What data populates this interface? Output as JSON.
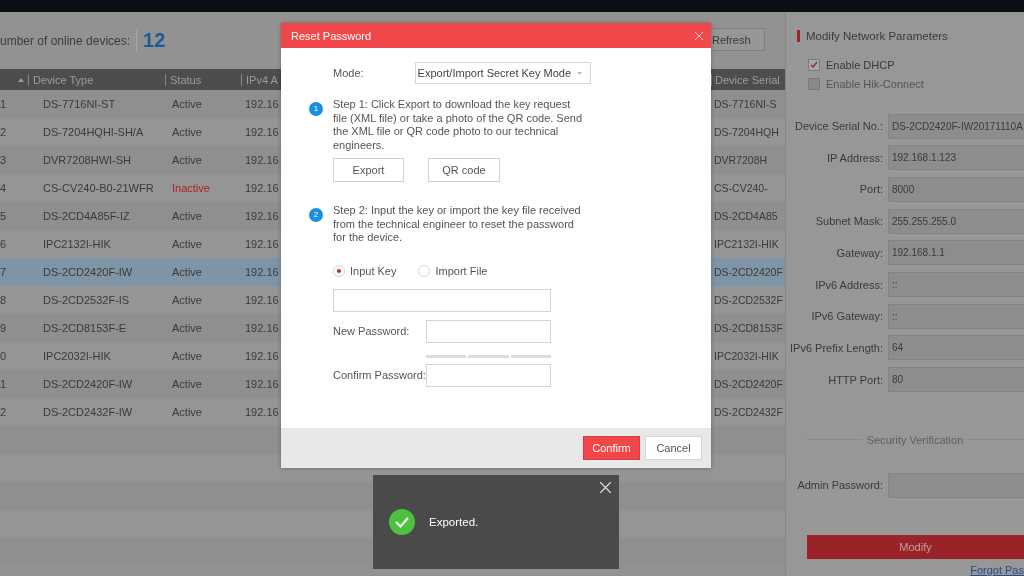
{
  "header": {
    "count_label": "umber of online devices:",
    "count": "12",
    "refresh": "Refresh"
  },
  "table": {
    "columns": [
      "Device Type",
      "Status",
      "IPv4 A",
      "Device Serial"
    ],
    "rows": [
      {
        "index": "1",
        "type": "DS-7716NI-ST",
        "status": "Active",
        "active": true,
        "ipv4": "192.16",
        "serial": "DS-7716NI-S",
        "selected": false
      },
      {
        "index": "2",
        "type": "DS-7204HQHI-SH/A",
        "status": "Active",
        "active": true,
        "ipv4": "192.16",
        "serial": "DS-7204HQH",
        "selected": false
      },
      {
        "index": "3",
        "type": "DVR7208HWI-SH",
        "status": "Active",
        "active": true,
        "ipv4": "192.16",
        "serial": "DVR7208H",
        "selected": false
      },
      {
        "index": "4",
        "type": "CS-CV240-B0-21WFR",
        "status": "Inactive",
        "active": false,
        "ipv4": "192.16",
        "serial": "CS-CV240-",
        "selected": false
      },
      {
        "index": "5",
        "type": "DS-2CD4A85F-IZ",
        "status": "Active",
        "active": true,
        "ipv4": "192.16",
        "serial": "DS-2CD4A85",
        "selected": false
      },
      {
        "index": "6",
        "type": "IPC2132I-HIK",
        "status": "Active",
        "active": true,
        "ipv4": "192.16",
        "serial": "IPC2132I-HIK",
        "selected": false
      },
      {
        "index": "7",
        "type": "DS-2CD2420F-IW",
        "status": "Active",
        "active": true,
        "ipv4": "192.16",
        "serial": "DS-2CD2420F",
        "selected": true
      },
      {
        "index": "8",
        "type": "DS-2CD2532F-IS",
        "status": "Active",
        "active": true,
        "ipv4": "192.16",
        "serial": "DS-2CD2532F",
        "selected": false
      },
      {
        "index": "9",
        "type": "DS-2CD8153F-E",
        "status": "Active",
        "active": true,
        "ipv4": "192.16",
        "serial": "DS-2CD8153F",
        "selected": false
      },
      {
        "index": "0",
        "type": "IPC2032I-HIK",
        "status": "Active",
        "active": true,
        "ipv4": "192.16",
        "serial": "IPC2032I-HIK",
        "selected": false
      },
      {
        "index": "1",
        "type": "DS-2CD2420F-IW",
        "status": "Active",
        "active": true,
        "ipv4": "192.16",
        "serial": "DS-2CD2420F",
        "selected": false
      },
      {
        "index": "2",
        "type": "DS-2CD2432F-IW",
        "status": "Active",
        "active": true,
        "ipv4": "192.16",
        "serial": "DS-2CD2432F",
        "selected": false
      }
    ]
  },
  "panel": {
    "title": "Modify Network Parameters",
    "checkboxes": [
      {
        "label": "Enable DHCP",
        "checked": true
      },
      {
        "label": "Enable Hik-Connect",
        "checked": false
      }
    ],
    "fields": [
      {
        "label": "Device Serial No.:",
        "value": "DS-2CD2420F-IW20171110A"
      },
      {
        "label": "IP Address:",
        "value": "192.168.1.123"
      },
      {
        "label": "Port:",
        "value": "8000"
      },
      {
        "label": "Subnet Mask:",
        "value": "255.255.255.0"
      },
      {
        "label": "Gateway:",
        "value": "192.168.1.1"
      },
      {
        "label": "IPv6 Address:",
        "value": "::"
      },
      {
        "label": "IPv6 Gateway:",
        "value": "::"
      },
      {
        "label": "IPv6 Prefix Length:",
        "value": "64"
      },
      {
        "label": "HTTP Port:",
        "value": "80"
      }
    ],
    "section": "Security Verification",
    "password_label": "Admin Password:",
    "button": "Modify",
    "link": "Forgot Pas"
  },
  "dialog": {
    "title": "Reset Password",
    "mode_label": "Mode:",
    "mode_value": "Export/Import Secret Key Mode",
    "steps": [
      {
        "number": "1",
        "text": "Step 1: Click Export to download the key request file (XML file) or take a photo of the QR code. Send the XML file or QR code photo to our technical engineers."
      },
      {
        "number": "2",
        "text": "Step 2: Input the key or import the key file received from the technical engineer to reset the password for the device."
      }
    ],
    "step_buttons": [
      "Export",
      "QR code"
    ],
    "radios": [
      {
        "label": "Input Key",
        "selected": true
      },
      {
        "label": "Import File",
        "selected": false
      }
    ],
    "new_password": "New Password:",
    "confirm_password": "Confirm Password:",
    "confirm": "Confirm",
    "cancel": "Cancel"
  },
  "toast": {
    "message": "Exported."
  }
}
